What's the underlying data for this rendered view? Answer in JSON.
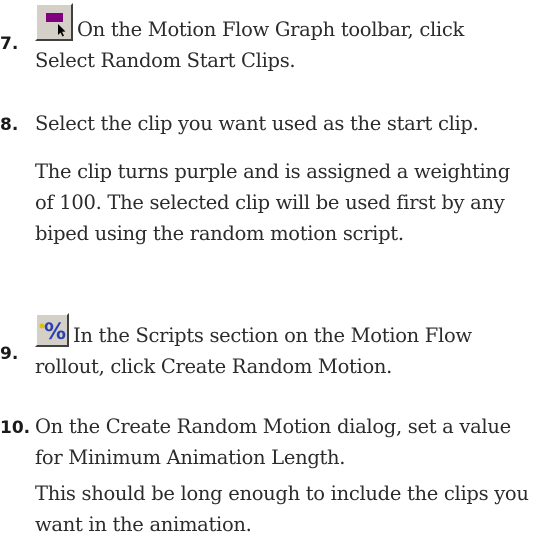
{
  "steps": [
    {
      "number": "7.",
      "icon": "select-random-start-clips-icon",
      "text": "On the Motion Flow Graph toolbar, click Select Random Start Clips."
    },
    {
      "number": "8.",
      "text": "Select the clip you want used as the start clip."
    },
    {
      "number": "9.",
      "icon": "create-random-motion-icon",
      "text": "In the Scripts section on the Motion Flow rollout, click Create Random Motion."
    },
    {
      "number": "10.",
      "text": "On the Create Random Motion dialog, set a value for Minimum Animation Length."
    }
  ],
  "notes": {
    "step8": "The clip turns purple and is assigned a weighting of 100. The selected clip will be used first by any biped using the random motion script.",
    "step10": "This should be long enough to include the clips you want in the animation."
  },
  "colors": {
    "clip_purple": "#800080",
    "percent_blue": "#2a3fb0",
    "toolbar_gray": "#d4d0c8"
  }
}
